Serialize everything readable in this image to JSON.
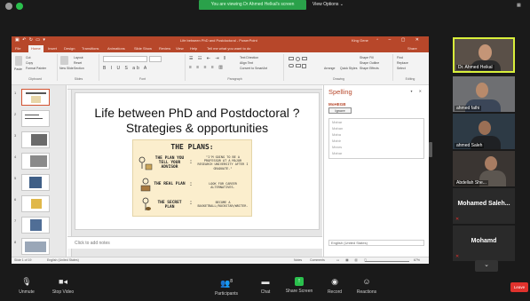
{
  "zoom_top": {
    "banner": "You are viewing Dr Ahmed Helkal's screen",
    "view_options": "View Options ⌄",
    "grid_icon": "grid-icon"
  },
  "powerpoint": {
    "title": "Life between PhD and Postdoctoral - PowerPoint",
    "user": "King Gene",
    "tabs": [
      "File",
      "Home",
      "Insert",
      "Design",
      "Transitions",
      "Animations",
      "Slide Show",
      "Review",
      "View",
      "Help",
      "Tell me what you want to do"
    ],
    "active_tab": "Home",
    "share": "Share",
    "ribbon": {
      "groups": [
        "Clipboard",
        "Slides",
        "Font",
        "Paragraph",
        "Drawing",
        "Editing"
      ],
      "clipboard_items": [
        "Cut",
        "Copy",
        "Format Painter"
      ],
      "paste": "Paste",
      "new_slide": "New Slide",
      "slides_items": [
        "Layout",
        "Reset",
        "Section"
      ],
      "paragraph_items": [
        "Text Direction",
        "Align Text",
        "Convert to SmartArt"
      ],
      "drawing_items": [
        "Arrange",
        "Quick Styles",
        "Shape Fill",
        "Shape Outline",
        "Shape Effects"
      ],
      "editing_items": [
        "Find",
        "Replace",
        "Select"
      ]
    },
    "slide_numbers": [
      "1",
      "2",
      "3",
      "4",
      "5",
      "6",
      "7",
      "8"
    ],
    "slide": {
      "title_line1": "Life between PhD and Postdoctoral ?",
      "title_line2": "Strategies & opportunities",
      "comic": {
        "header": "THE PLANS:",
        "plans": [
          {
            "name": "THE PLAN YOU TELL YOUR ADVISOR",
            "desc": "\"I'M GOING TO BE A PROFESSOR AT A MAJOR RESEARCH UNIVERSITY AFTER I GRADUATE.\""
          },
          {
            "name": "THE REAL PLAN",
            "desc": "LOOK FOR CAREER ALTERNATIVES."
          },
          {
            "name": "THE SECRET PLAN",
            "desc": "BECOME A BASKETBALL/ROCKSTAR/WRITER."
          }
        ]
      }
    },
    "notes_placeholder": "Click to add notes",
    "spelling": {
      "title": "Spelling",
      "word": "MoHEGB",
      "ignore": "Ignore",
      "suggestions": [
        "Mahar",
        "Mahan",
        "Maha",
        "Mahir",
        "Mears",
        "Mahar"
      ],
      "language": "English (United States)"
    },
    "status": {
      "slide": "Slide 1 of 19",
      "language": "English (United States)",
      "notes": "Notes",
      "comments": "Comments",
      "zoom": "67%"
    }
  },
  "participants": [
    {
      "name": "Dr. Ahmed Heikal",
      "speaking": true
    },
    {
      "name": "ahmed fathi",
      "speaking": false
    },
    {
      "name": "ahmed Saleh",
      "speaking": false
    },
    {
      "name": "Abdellah She...",
      "speaking": false
    },
    {
      "name": "Mohamed Saleh...",
      "speaking": false,
      "video": false
    },
    {
      "name": "Mohamd",
      "speaking": false,
      "video": false
    }
  ],
  "toolbar": {
    "unmute": "Unmute",
    "stop_video": "Stop Video",
    "participants": "Participants",
    "participants_count": "8",
    "chat": "Chat",
    "share_screen": "Share Screen",
    "record": "Record",
    "reactions": "Reactions",
    "leave": "Leave"
  }
}
